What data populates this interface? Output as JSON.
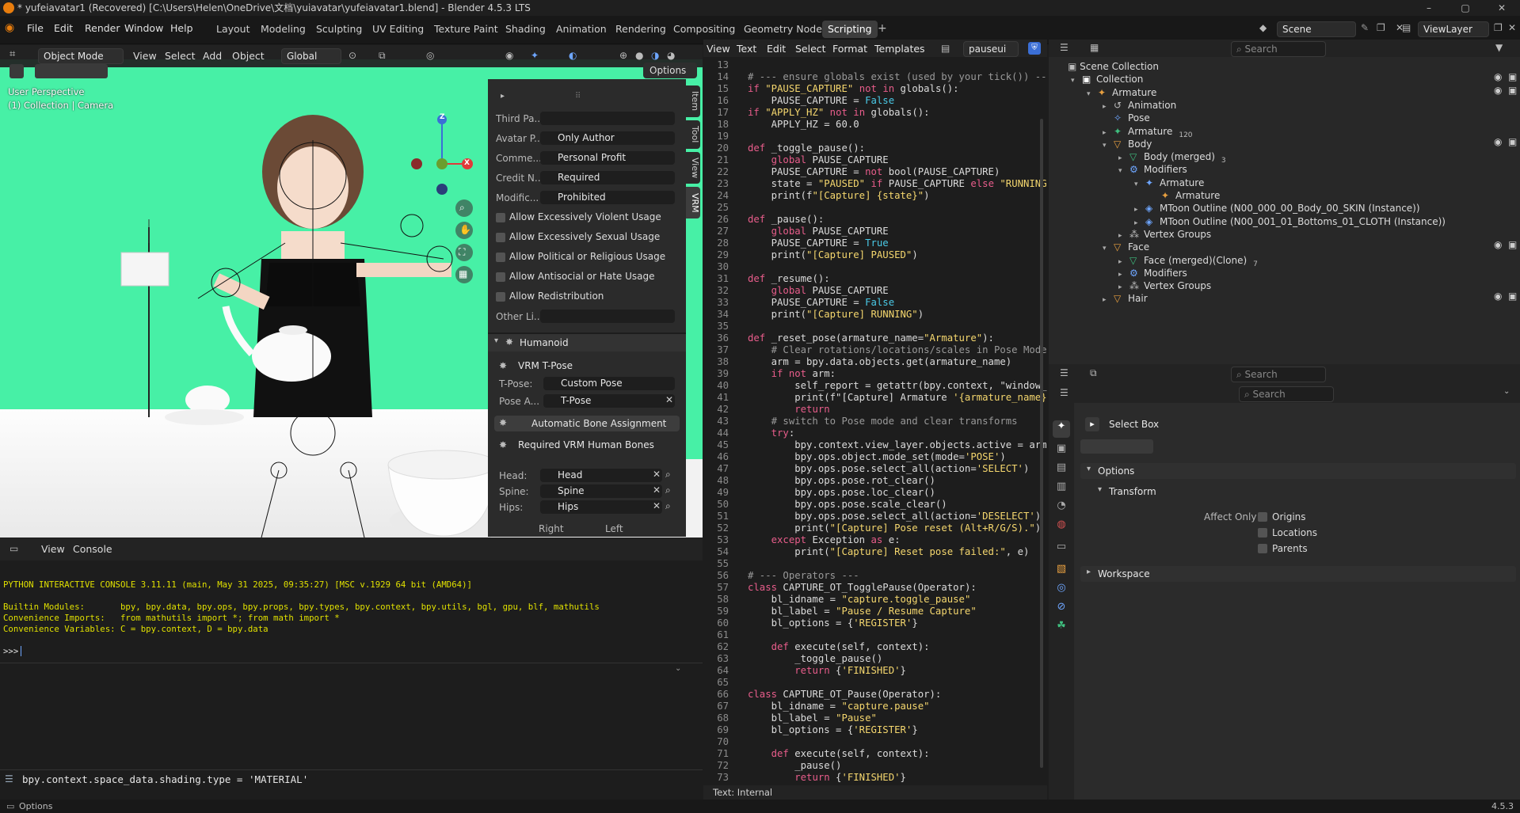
{
  "titlebar": {
    "title": "* yufeiavatar1 (Recovered) [C:\\Users\\Helen\\OneDrive\\文档\\yuiavatar\\yufeiavatar1.blend] - Blender 4.5.3 LTS"
  },
  "menus": [
    "File",
    "Edit",
    "Render",
    "Window",
    "Help"
  ],
  "workspaces": [
    "Layout",
    "Modeling",
    "Sculpting",
    "UV Editing",
    "Texture Paint",
    "Shading",
    "Animation",
    "Rendering",
    "Compositing",
    "Geometry Nodes",
    "Scripting"
  ],
  "active_workspace": "Scripting",
  "scene": {
    "name": "Scene",
    "view_layer": "ViewLayer"
  },
  "viewport": {
    "mode": "Object Mode",
    "menus": [
      "View",
      "Select",
      "Add",
      "Object"
    ],
    "transform_orientation": "Global",
    "options_label": "Options",
    "overlay_line1": "User Perspective",
    "overlay_line2": "(1) Collection | Camera",
    "gizmo_axes": [
      "Z",
      "X"
    ]
  },
  "npanel": {
    "tabs": [
      "Item",
      "Tool",
      "View",
      "VRM"
    ],
    "fields": [
      {
        "label": "Third Pa...",
        "value": ""
      },
      {
        "label": "Avatar P...",
        "value": "Only Author"
      },
      {
        "label": "Comme...",
        "value": "Personal Profit"
      },
      {
        "label": "Credit N...",
        "value": "Required"
      },
      {
        "label": "Modific...",
        "value": "Prohibited"
      }
    ],
    "checkboxes": [
      "Allow Excessively Violent Usage",
      "Allow Excessively Sexual Usage",
      "Allow Political or Religious Usage",
      "Allow Antisocial or Hate Usage",
      "Allow Redistribution"
    ],
    "other_label": "Other Li...",
    "humanoid": {
      "title": "Humanoid",
      "tpose_header": "VRM T-Pose",
      "tpose_label": "T-Pose:",
      "tpose_value": "Custom Pose",
      "pose_label": "Pose A...",
      "pose_value": "T-Pose",
      "auto_button": "Automatic Bone Assignment",
      "required_header": "Required VRM Human Bones",
      "bones": [
        {
          "label": "Head:",
          "value": "Head"
        },
        {
          "label": "Spine:",
          "value": "Spine"
        },
        {
          "label": "Hips:",
          "value": "Hips"
        }
      ],
      "right_label": "Right",
      "left_label": "Left"
    }
  },
  "console": {
    "menus": [
      "View",
      "Console"
    ],
    "lines": [
      "PYTHON INTERACTIVE CONSOLE 3.11.11 (main, May 31 2025, 09:35:27) [MSC v.1929 64 bit (AMD64)]",
      "",
      "Builtin Modules:       bpy, bpy.data, bpy.ops, bpy.props, bpy.types, bpy.context, bpy.utils, bgl, gpu, blf, mathutils",
      "Convenience Imports:   from mathutils import *; from math import *",
      "Convenience Variables: C = bpy.context, D = bpy.data"
    ],
    "prompt": ">>> ",
    "info_line": "bpy.context.space_data.shading.type = 'MATERIAL'"
  },
  "texteditor": {
    "menus": [
      "View",
      "Text",
      "Edit",
      "Select",
      "Format",
      "Templates"
    ],
    "filename": "pauseui",
    "footer": "Text: Internal",
    "lines": [
      {
        "n": "13",
        "t": ""
      },
      {
        "n": "14",
        "t": "# --- ensure globals exist (used by your tick()) ---"
      },
      {
        "n": "15",
        "t": "if \"PAUSE_CAPTURE\" not in globals():"
      },
      {
        "n": "16",
        "t": "    PAUSE_CAPTURE = False"
      },
      {
        "n": "17",
        "t": "if \"APPLY_HZ\" not in globals():"
      },
      {
        "n": "18",
        "t": "    APPLY_HZ = 60.0"
      },
      {
        "n": "19",
        "t": ""
      },
      {
        "n": "20",
        "t": "def _toggle_pause():"
      },
      {
        "n": "21",
        "t": "    global PAUSE_CAPTURE"
      },
      {
        "n": "22",
        "t": "    PAUSE_CAPTURE = not bool(PAUSE_CAPTURE)"
      },
      {
        "n": "23",
        "t": "    state = \"PAUSED\" if PAUSE_CAPTURE else \"RUNNING\""
      },
      {
        "n": "24",
        "t": "    print(f\"[Capture] {state}\")"
      },
      {
        "n": "25",
        "t": ""
      },
      {
        "n": "26",
        "t": "def _pause():"
      },
      {
        "n": "27",
        "t": "    global PAUSE_CAPTURE"
      },
      {
        "n": "28",
        "t": "    PAUSE_CAPTURE = True"
      },
      {
        "n": "29",
        "t": "    print(\"[Capture] PAUSED\")"
      },
      {
        "n": "30",
        "t": ""
      },
      {
        "n": "31",
        "t": "def _resume():"
      },
      {
        "n": "32",
        "t": "    global PAUSE_CAPTURE"
      },
      {
        "n": "33",
        "t": "    PAUSE_CAPTURE = False"
      },
      {
        "n": "34",
        "t": "    print(\"[Capture] RUNNING\")"
      },
      {
        "n": "35",
        "t": ""
      },
      {
        "n": "36",
        "t": "def _reset_pose(armature_name=\"Armature\"):"
      },
      {
        "n": "37",
        "t": "    # Clear rotations/locations/scales in Pose Mode (A"
      },
      {
        "n": "38",
        "t": "    arm = bpy.data.objects.get(armature_name)"
      },
      {
        "n": "39",
        "t": "    if not arm:"
      },
      {
        "n": "40",
        "t": "        self_report = getattr(bpy.context, \"window_man"
      },
      {
        "n": "41",
        "t": "        print(f\"[Capture] Armature '{armature_name}' n"
      },
      {
        "n": "42",
        "t": "        return"
      },
      {
        "n": "43",
        "t": "    # switch to Pose mode and clear transforms"
      },
      {
        "n": "44",
        "t": "    try:"
      },
      {
        "n": "45",
        "t": "        bpy.context.view_layer.objects.active = arm"
      },
      {
        "n": "46",
        "t": "        bpy.ops.object.mode_set(mode='POSE')"
      },
      {
        "n": "47",
        "t": "        bpy.ops.pose.select_all(action='SELECT')"
      },
      {
        "n": "48",
        "t": "        bpy.ops.pose.rot_clear()"
      },
      {
        "n": "49",
        "t": "        bpy.ops.pose.loc_clear()"
      },
      {
        "n": "50",
        "t": "        bpy.ops.pose.scale_clear()"
      },
      {
        "n": "51",
        "t": "        bpy.ops.pose.select_all(action='DESELECT')"
      },
      {
        "n": "52",
        "t": "        print(\"[Capture] Pose reset (Alt+R/G/S).\")"
      },
      {
        "n": "53",
        "t": "    except Exception as e:"
      },
      {
        "n": "54",
        "t": "        print(\"[Capture] Reset pose failed:\", e)"
      },
      {
        "n": "55",
        "t": ""
      },
      {
        "n": "56",
        "t": "# --- Operators ---"
      },
      {
        "n": "57",
        "t": "class CAPTURE_OT_TogglePause(Operator):"
      },
      {
        "n": "58",
        "t": "    bl_idname = \"capture.toggle_pause\""
      },
      {
        "n": "59",
        "t": "    bl_label = \"Pause / Resume Capture\""
      },
      {
        "n": "60",
        "t": "    bl_options = {'REGISTER'}"
      },
      {
        "n": "61",
        "t": ""
      },
      {
        "n": "62",
        "t": "    def execute(self, context):"
      },
      {
        "n": "63",
        "t": "        _toggle_pause()"
      },
      {
        "n": "64",
        "t": "        return {'FINISHED'}"
      },
      {
        "n": "65",
        "t": ""
      },
      {
        "n": "66",
        "t": "class CAPTURE_OT_Pause(Operator):"
      },
      {
        "n": "67",
        "t": "    bl_idname = \"capture.pause\""
      },
      {
        "n": "68",
        "t": "    bl_label = \"Pause\""
      },
      {
        "n": "69",
        "t": "    bl_options = {'REGISTER'}"
      },
      {
        "n": "70",
        "t": ""
      },
      {
        "n": "71",
        "t": "    def execute(self, context):"
      },
      {
        "n": "72",
        "t": "        _pause()"
      },
      {
        "n": "73",
        "t": "        return {'FINISHED'}"
      }
    ]
  },
  "outliner": {
    "search_placeholder": "Search",
    "root": "Scene Collection",
    "rows": [
      {
        "indent": 1,
        "label": "Collection",
        "tri": "v",
        "icon": "collection-icon",
        "badge": ""
      },
      {
        "indent": 2,
        "label": "Armature",
        "tri": "v",
        "icon": "armature-object-icon",
        "badge": ""
      },
      {
        "indent": 3,
        "label": "Animation",
        "tri": ">",
        "icon": "animation-icon",
        "badge": ""
      },
      {
        "indent": 3,
        "label": "Pose",
        "tri": "",
        "icon": "pose-icon",
        "badge": ""
      },
      {
        "indent": 3,
        "label": "Armature",
        "tri": ">",
        "icon": "armature-data-icon",
        "badge": "120"
      },
      {
        "indent": 3,
        "label": "Body",
        "tri": "v",
        "icon": "mesh-object-icon",
        "badge": ""
      },
      {
        "indent": 4,
        "label": "Body (merged)",
        "tri": ">",
        "icon": "mesh-data-icon",
        "badge": "3"
      },
      {
        "indent": 4,
        "label": "Modifiers",
        "tri": "v",
        "icon": "wrench-icon",
        "badge": ""
      },
      {
        "indent": 5,
        "label": "Armature",
        "tri": "v",
        "icon": "armature-modifier-icon",
        "badge": ""
      },
      {
        "indent": 6,
        "label": "Armature",
        "tri": "",
        "icon": "armature-object-icon",
        "badge": ""
      },
      {
        "indent": 5,
        "label": "MToon Outline (N00_000_00_Body_00_SKIN (Instance))",
        "tri": ">",
        "icon": "geometry-nodes-icon",
        "badge": ""
      },
      {
        "indent": 5,
        "label": "MToon Outline (N00_001_01_Bottoms_01_CLOTH (Instance))",
        "tri": ">",
        "icon": "geometry-nodes-icon",
        "badge": ""
      },
      {
        "indent": 4,
        "label": "Vertex Groups",
        "tri": ">",
        "icon": "vertex-groups-icon",
        "badge": ""
      },
      {
        "indent": 3,
        "label": "Face",
        "tri": "v",
        "icon": "mesh-object-icon",
        "badge": ""
      },
      {
        "indent": 4,
        "label": "Face (merged)(Clone)",
        "tri": ">",
        "icon": "mesh-data-icon",
        "badge": "7"
      },
      {
        "indent": 4,
        "label": "Modifiers",
        "tri": ">",
        "icon": "wrench-icon",
        "badge": ""
      },
      {
        "indent": 4,
        "label": "Vertex Groups",
        "tri": ">",
        "icon": "vertex-groups-icon",
        "badge": ""
      },
      {
        "indent": 3,
        "label": "Hair",
        "tri": ">",
        "icon": "mesh-object-icon",
        "badge": ""
      }
    ]
  },
  "properties": {
    "search_placeholder": "Search",
    "tool_name": "Select Box",
    "options_header": "Options",
    "transform_header": "Transform",
    "affect_only_label": "Affect Only",
    "affect_options": [
      "Origins",
      "Locations",
      "Parents"
    ],
    "workspace_header": "Workspace"
  },
  "statusbar": {
    "left": "Options",
    "version": "4.5.3"
  }
}
